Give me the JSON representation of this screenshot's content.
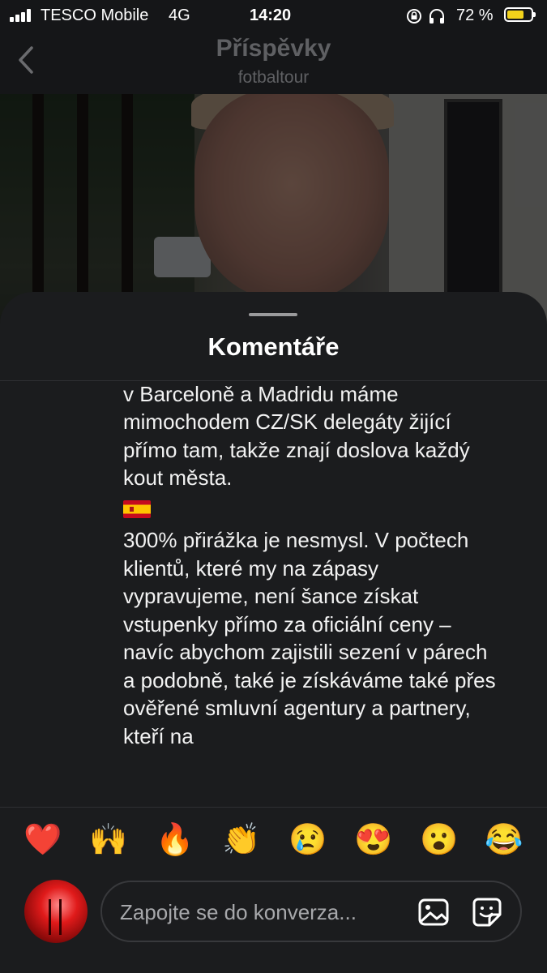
{
  "status_bar": {
    "carrier": "TESCO Mobile",
    "network": "4G",
    "time": "14:20",
    "battery_percent": "72 %",
    "battery_level": 0.72,
    "icons": [
      "signal-icon",
      "rotation-lock-icon",
      "headphones-icon",
      "battery-icon"
    ]
  },
  "nav": {
    "title": "Příspěvky",
    "subtitle": "fotbaltour",
    "back_icon": "chevron-left-icon"
  },
  "sheet": {
    "title": "Komentáře"
  },
  "comment": {
    "paragraph1": "El Clásica je pokaždé delegát na místě – v Barceloně a Madridu máme mimochodem CZ/SK delegáty žijící přímo tam, takže znají doslova každý kout města.",
    "flag_icon": "spain-flag-icon",
    "paragraph2": "300% přirážka je nesmysl. V počtech klientů, které my na zápasy vypravujeme, není šance získat vstupenky přímo za oficiální ceny – navíc abychom zajistili sezení v párech a podobně, také je získáváme také přes ověřené smluvní agentury a partnery, kteří na"
  },
  "reactions": [
    "❤️",
    "🙌",
    "🔥",
    "👏",
    "😢",
    "😍",
    "😮",
    "😂"
  ],
  "composer": {
    "placeholder": "Zapojte se do konverza...",
    "gallery_icon": "image-gallery-icon",
    "sticker_icon": "sticker-icon"
  }
}
